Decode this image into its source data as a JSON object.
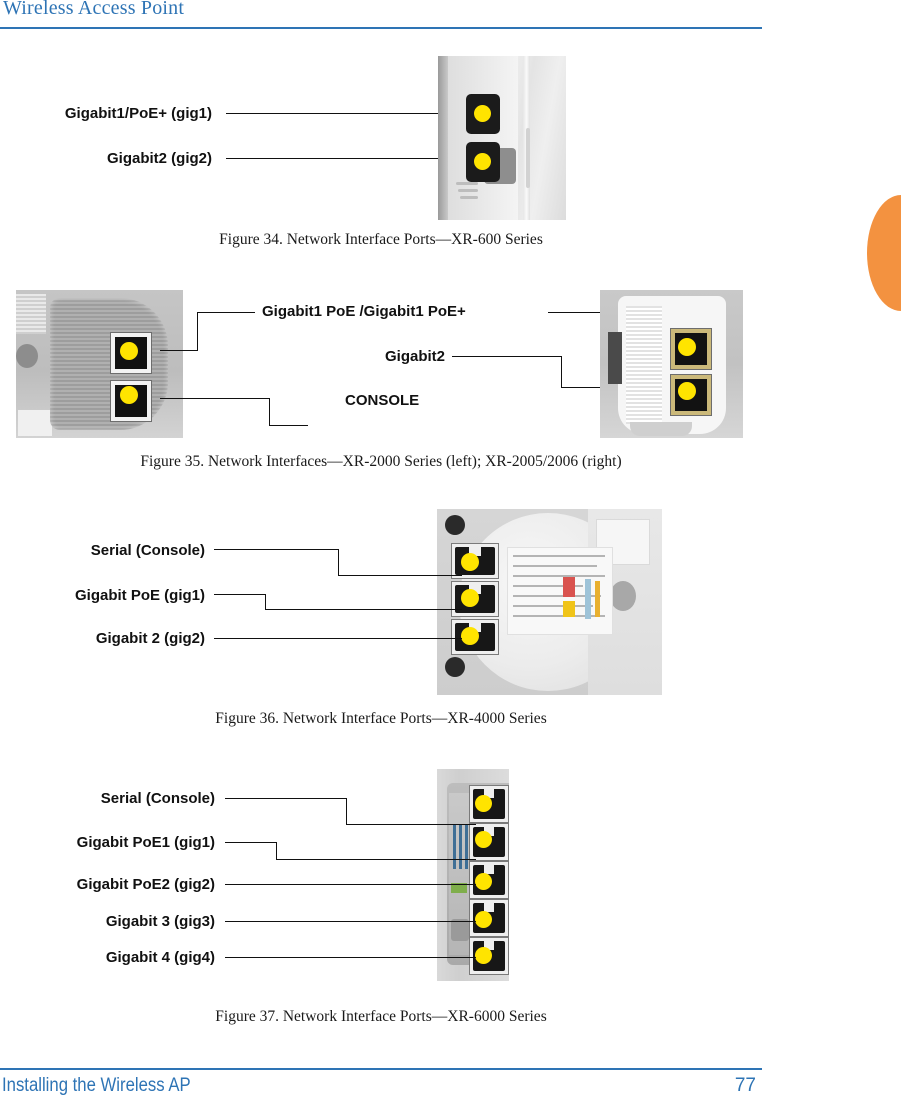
{
  "header": {
    "title": "Wireless Access Point"
  },
  "footer": {
    "section": "Installing the Wireless AP",
    "page_number": "77"
  },
  "colors": {
    "accent_blue": "#2E74B5",
    "tab_orange": "#F39240",
    "port_marker_yellow": "#FFE400",
    "leader_line": "#111111"
  },
  "figures": [
    {
      "id": "figure-34",
      "caption": "Figure 34. Network Interface Ports—XR-600 Series",
      "photo_alt": "XR-600 Series access point edge showing two network ports",
      "callouts": [
        {
          "label": "Gigabit1/PoE+ (gig1)"
        },
        {
          "label": "Gigabit2 (gig2)"
        }
      ]
    },
    {
      "id": "figure-35",
      "caption": "Figure 35. Network Interfaces—XR-2000 Series (left); XR-2005/2006 (right)",
      "photo_alt_left": "XR-2000 Series interface panel with two ports",
      "photo_alt_right": "XR-2005/2006 interface panel with two ports",
      "callouts": [
        {
          "label": "Gigabit1 PoE /Gigabit1 PoE+"
        },
        {
          "label": "Gigabit2"
        },
        {
          "label": "CONSOLE"
        }
      ]
    },
    {
      "id": "figure-36",
      "caption": "Figure 36. Network Interface Ports—XR-4000 Series",
      "photo_alt": "XR-4000 Series underside showing three stacked ports",
      "callouts": [
        {
          "label": "Serial (Console)"
        },
        {
          "label": "Gigabit PoE (gig1)"
        },
        {
          "label": "Gigabit 2 (gig2)"
        }
      ]
    },
    {
      "id": "figure-37",
      "caption": "Figure 37. Network Interface Ports—XR-6000 Series",
      "photo_alt": "XR-6000 Series port bay showing five stacked ports",
      "callouts": [
        {
          "label": "Serial (Console)"
        },
        {
          "label": "Gigabit PoE1 (gig1)"
        },
        {
          "label": "Gigabit PoE2 (gig2)"
        },
        {
          "label": "Gigabit 3 (gig3)"
        },
        {
          "label": "Gigabit 4 (gig4)"
        }
      ]
    }
  ]
}
